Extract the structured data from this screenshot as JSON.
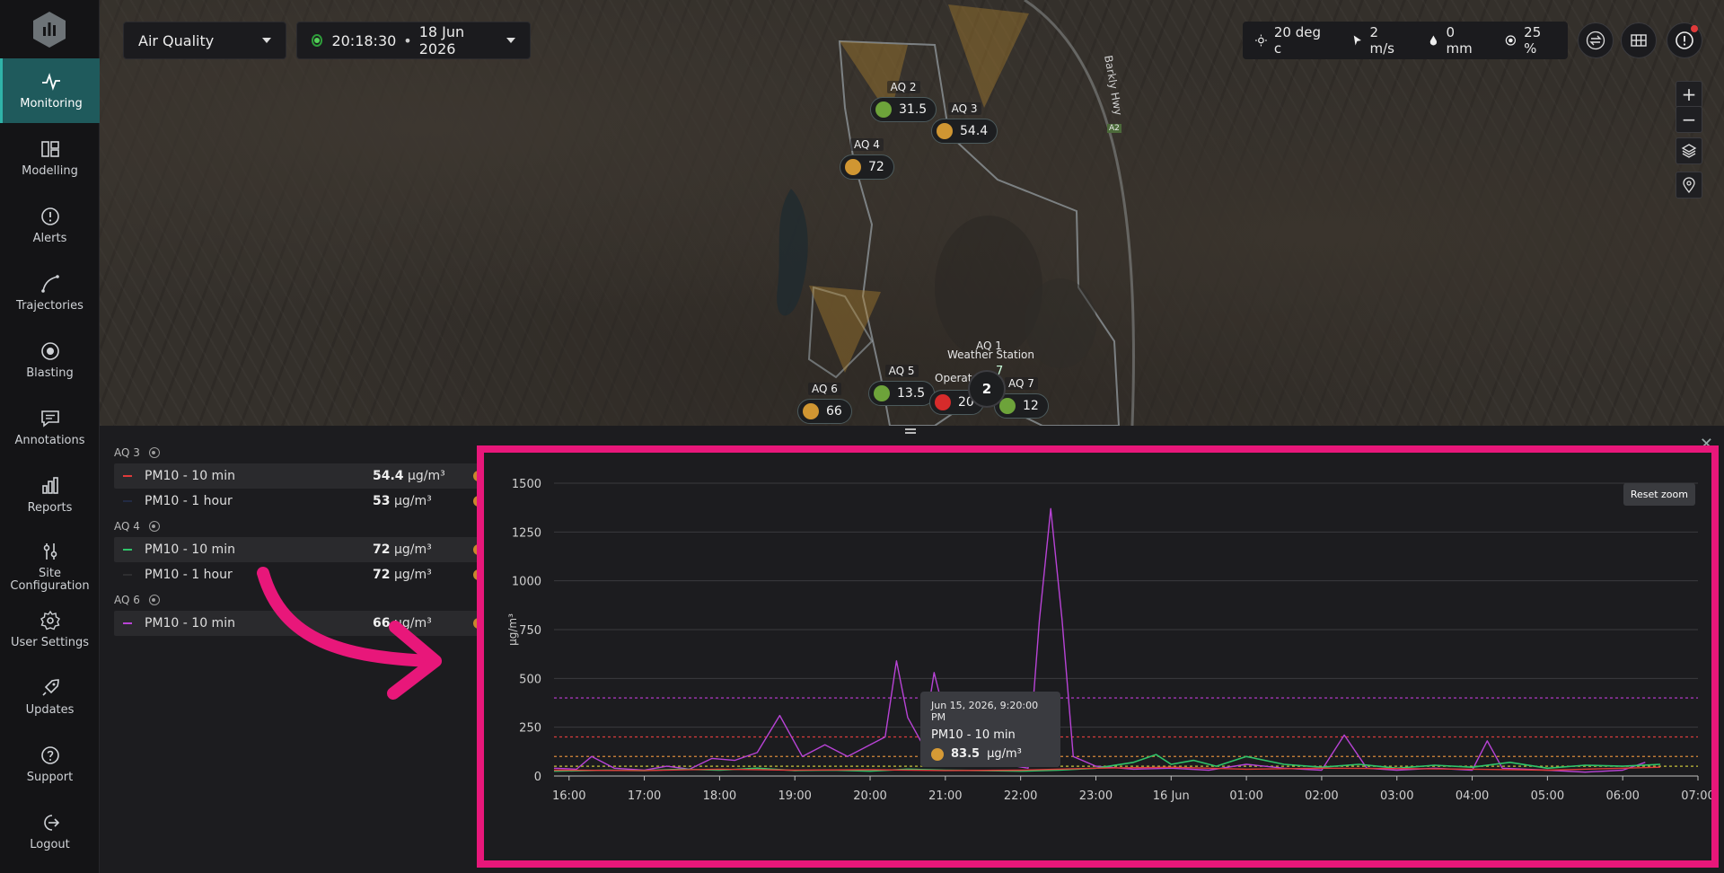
{
  "sidebar": {
    "items": [
      {
        "label": "Monitoring",
        "icon": "activity-icon"
      },
      {
        "label": "Modelling",
        "icon": "modelling-icon"
      },
      {
        "label": "Alerts",
        "icon": "alert-icon"
      },
      {
        "label": "Trajectories",
        "icon": "trajectory-icon"
      },
      {
        "label": "Blasting",
        "icon": "blasting-icon"
      },
      {
        "label": "Annotations",
        "icon": "annotation-icon"
      },
      {
        "label": "Reports",
        "icon": "reports-icon"
      },
      {
        "label": "Site Configuration",
        "icon": "sliders-icon"
      },
      {
        "label": "User Settings",
        "icon": "gear-icon"
      },
      {
        "label": "Updates",
        "icon": "rocket-icon"
      },
      {
        "label": "Support",
        "icon": "help-icon"
      },
      {
        "label": "Logout",
        "icon": "logout-icon"
      }
    ]
  },
  "topbar": {
    "layer_select": "Air Quality",
    "time": "20:18:30",
    "date": "18 Jun 2026",
    "separator": "•"
  },
  "weather": {
    "temperature": "20 deg c",
    "wind": "2 m/s",
    "rain": "0 mm",
    "humidity": "25 %"
  },
  "map": {
    "road_label": "Barkly Hwy",
    "road_shield": "A2",
    "markers": [
      {
        "name": "AQ 2",
        "value": "31.5",
        "color": "#6da33a"
      },
      {
        "name": "AQ 3",
        "value": "54.4",
        "color": "#d09632"
      },
      {
        "name": "AQ 4",
        "value": "72",
        "color": "#d09632"
      },
      {
        "name": "AQ 5",
        "value": "13.5",
        "color": "#6da33a"
      },
      {
        "name": "AQ 6",
        "value": "66",
        "color": "#d09632"
      },
      {
        "name": "AQ 7",
        "value": "12",
        "color": "#6da33a"
      }
    ],
    "cluster_count": "2",
    "weather_station_label": "Weather Station",
    "aq1_label": "AQ 1",
    "partial_label": "Operat",
    "partial_value": "20",
    "partial_color": "#d62b2b",
    "partial_value_suffix": "7"
  },
  "series_list": {
    "groups": [
      {
        "name": "AQ 3",
        "rows": [
          {
            "label": "PM10 - 10 min",
            "value": "54.4",
            "unit": "µg/m³",
            "color": "#e03a3a",
            "status": "#c8862e",
            "selected": true
          },
          {
            "label": "PM10 - 1 hour",
            "value": "53",
            "unit": "µg/m³",
            "color": "#222a44",
            "status": "#c8862e",
            "selected": false
          }
        ]
      },
      {
        "name": "AQ 4",
        "rows": [
          {
            "label": "PM10 - 10 min",
            "value": "72",
            "unit": "µg/m³",
            "color": "#2fc46a",
            "status": "#c8862e",
            "selected": true
          },
          {
            "label": "PM10 - 1 hour",
            "value": "72",
            "unit": "µg/m³",
            "color": "#2e2e30",
            "status": "#c8862e",
            "selected": false
          }
        ]
      },
      {
        "name": "AQ 6",
        "rows": [
          {
            "label": "PM10 - 10 min",
            "value": "66",
            "unit": "µg/m³",
            "color": "#b843d6",
            "status": "#c8862e",
            "selected": true
          }
        ]
      }
    ]
  },
  "chart": {
    "reset_zoom": "Reset zoom",
    "tooltip": {
      "date": "Jun 15, 2026, 9:20:00 PM",
      "series": "PM10 - 10 min",
      "value": "83.5",
      "unit": "µg/m³"
    }
  },
  "chart_data": {
    "type": "line",
    "ylabel": "µg/m³",
    "ylim": [
      0,
      1500
    ],
    "yticks": [
      0,
      250,
      500,
      750,
      1000,
      1250,
      1500
    ],
    "xlim": [
      15.8,
      31
    ],
    "x_tick_labels": [
      "16:00",
      "17:00",
      "18:00",
      "19:00",
      "20:00",
      "21:00",
      "22:00",
      "23:00",
      "16 Jun",
      "01:00",
      "02:00",
      "03:00",
      "04:00",
      "05:00",
      "06:00",
      "07:00"
    ],
    "thresholds": [
      {
        "value": 400,
        "color": "#c03bd6"
      },
      {
        "value": 200,
        "color": "#d63b3b"
      },
      {
        "value": 100,
        "color": "#d6893b"
      },
      {
        "value": 50,
        "color": "#c6c23b"
      }
    ],
    "series": [
      {
        "name": "AQ 6 PM10 - 10 min",
        "color": "#b843d6",
        "x": [
          15.8,
          16.1,
          16.3,
          16.6,
          17.0,
          17.3,
          17.6,
          17.9,
          18.2,
          18.5,
          18.8,
          19.1,
          19.4,
          19.7,
          19.9,
          20.2,
          20.35,
          20.5,
          20.7,
          20.85,
          21.0,
          21.2,
          21.5,
          21.8,
          22.1,
          22.25,
          22.4,
          22.55,
          22.7,
          23.0,
          23.5,
          24.0,
          24.5,
          25.0,
          25.5,
          26.0,
          26.3,
          26.6,
          27.0,
          27.5,
          28.0,
          28.2,
          28.4,
          29.0,
          29.5,
          30.0,
          30.3
        ],
        "y": [
          40,
          35,
          100,
          40,
          30,
          50,
          35,
          90,
          80,
          120,
          310,
          100,
          160,
          100,
          140,
          200,
          590,
          300,
          160,
          530,
          300,
          120,
          90,
          60,
          40,
          800,
          1370,
          800,
          100,
          50,
          35,
          40,
          30,
          60,
          40,
          30,
          210,
          40,
          30,
          40,
          30,
          180,
          40,
          30,
          20,
          30,
          70
        ]
      },
      {
        "name": "AQ 4 PM10 - 10 min",
        "color": "#2fc46a",
        "x": [
          15.8,
          16.5,
          17.0,
          17.5,
          18.0,
          18.5,
          19.0,
          19.5,
          20.0,
          20.5,
          21.0,
          21.5,
          22.0,
          22.5,
          23.0,
          23.5,
          23.8,
          24.0,
          24.3,
          24.6,
          25.0,
          25.5,
          26.0,
          26.5,
          27.0,
          27.5,
          28.0,
          28.5,
          29.0,
          29.5,
          30.0,
          30.5
        ],
        "y": [
          25,
          30,
          28,
          35,
          30,
          40,
          28,
          30,
          25,
          35,
          30,
          28,
          25,
          30,
          40,
          70,
          110,
          60,
          80,
          50,
          100,
          60,
          45,
          60,
          40,
          55,
          45,
          70,
          40,
          55,
          50,
          60
        ]
      },
      {
        "name": "AQ 3 PM10 - 10 min",
        "color": "#e03a3a",
        "x": [
          15.8,
          17.0,
          18.0,
          19.0,
          20.0,
          21.0,
          22.0,
          23.0,
          24.0,
          25.0,
          26.0,
          27.0,
          28.0,
          29.0,
          30.0,
          30.5
        ],
        "y": [
          30,
          28,
          35,
          30,
          32,
          28,
          30,
          40,
          45,
          35,
          40,
          38,
          35,
          30,
          40,
          45
        ]
      }
    ]
  }
}
